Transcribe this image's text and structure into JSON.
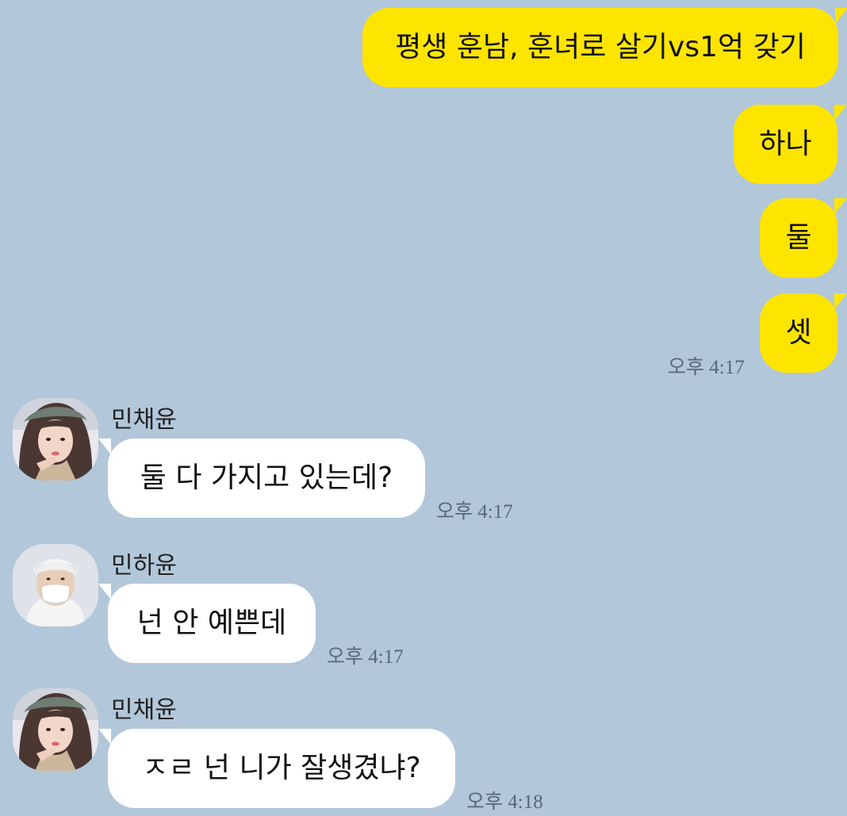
{
  "chat": {
    "my_messages": [
      "평생 훈남, 훈녀로 살기vs1억 갖기",
      "하나",
      "둘",
      "셋"
    ],
    "my_time": "오후 4:17",
    "received": [
      {
        "sender": "민채윤",
        "text": "둘 다 가지고 있는데?",
        "time": "오후 4:17",
        "avatar": "avatar-girl-photo"
      },
      {
        "sender": "민하윤",
        "text": "넌 안 예쁜데",
        "time": "오후 4:17",
        "avatar": "avatar-masked-person-photo"
      },
      {
        "sender": "민채윤",
        "text": "ㅈㄹ 넌 니가 잘생겼냐?",
        "time": "오후 4:18",
        "avatar": "avatar-girl-photo"
      }
    ]
  },
  "colors": {
    "background": "#b2c7d9",
    "my_bubble": "#fee500",
    "their_bubble": "#ffffff"
  }
}
